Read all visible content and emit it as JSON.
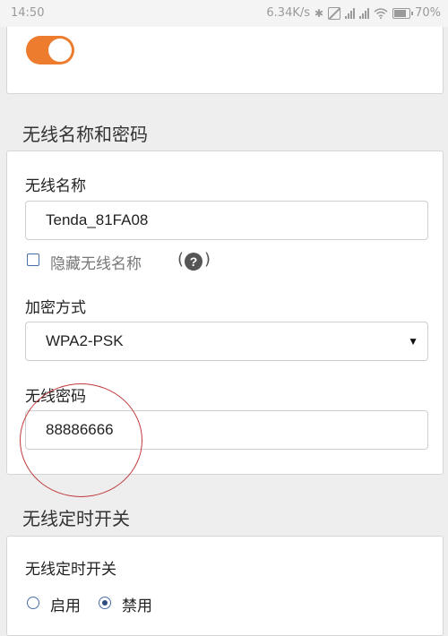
{
  "status_bar": {
    "time": "14:50",
    "net_speed": "6.34K/s",
    "battery": "70%",
    "icons": [
      "bluetooth-icon",
      "mute-icon",
      "signal-icon",
      "signal-icon",
      "wifi-icon",
      "battery-icon"
    ]
  },
  "toggle": {
    "on": true,
    "color": "#ee7c2e"
  },
  "wireless_section": {
    "title": "无线名称和密码",
    "ssid_label": "无线名称",
    "ssid_value": "Tenda_81FA08",
    "hide_ssid_label": "隐藏无线名称",
    "hide_ssid_checked": false,
    "help_symbol": "?",
    "encryption_label": "加密方式",
    "encryption_value": "WPA2-PSK",
    "password_label": "无线密码",
    "password_value": "88886666"
  },
  "timer_section": {
    "title": "无线定时开关",
    "label": "无线定时开关",
    "options": [
      "启用",
      "禁用"
    ],
    "selected": "禁用"
  },
  "colors": {
    "accent": "#ee7c2e",
    "annotation": "#c0393b"
  }
}
